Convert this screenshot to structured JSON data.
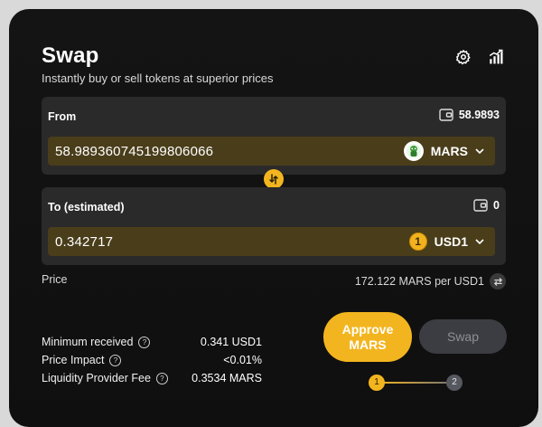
{
  "header": {
    "title": "Swap",
    "subtitle": "Instantly buy or sell tokens at superior prices",
    "settings_icon": "gear-icon",
    "chart_icon": "bar-chart-icon"
  },
  "from": {
    "label": "From",
    "balance": "58.9893",
    "amount": "58.989360745199806066",
    "token": "MARS",
    "token_icon": "mars-token-icon"
  },
  "to": {
    "label": "To (estimated)",
    "balance": "0",
    "amount": "0.342717",
    "token": "USD1",
    "token_icon": "usd1-token-icon",
    "token_icon_glyph": "1"
  },
  "price": {
    "label": "Price",
    "value": "172.122 MARS per USD1"
  },
  "stats": [
    {
      "label": "Minimum received",
      "value": "0.341 USD1"
    },
    {
      "label": "Price Impact",
      "value": "<0.01%"
    },
    {
      "label": "Liquidity Provider Fee",
      "value": "0.3534 MARS"
    }
  ],
  "actions": {
    "approve_label_line1": "Approve",
    "approve_label_line2": "MARS",
    "swap_label": "Swap"
  },
  "steps": {
    "step1": "1",
    "step2": "2"
  },
  "colors": {
    "accent": "#f3b51f",
    "panel": "#2a2a2a",
    "input": "#4a3d1a",
    "disabled": "#3c3d42"
  }
}
